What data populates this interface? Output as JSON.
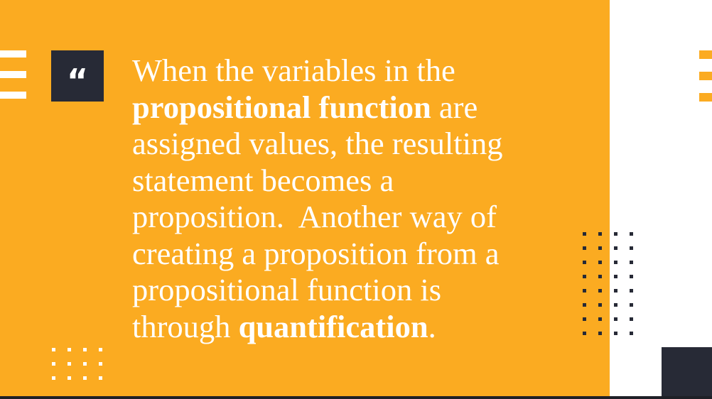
{
  "slide": {
    "colors": {
      "accent": "#fbab21",
      "dark": "#272a36",
      "text": "#ffffff",
      "background": "#ffffff"
    },
    "quote_icon": {
      "name": "quote-mark-icon",
      "glyph": "“"
    },
    "quote_segments": [
      {
        "text": "When the variables in the",
        "bold": false
      },
      {
        "text": "propositional function",
        "bold": true
      },
      {
        "text": " are",
        "bold": false
      },
      {
        "text": "assigned values, the resulting",
        "bold": false
      },
      {
        "text": "statement becomes a",
        "bold": false
      },
      {
        "text": "proposition.  Another way of",
        "bold": false
      },
      {
        "text": "creating a proposition from a",
        "bold": false
      },
      {
        "text": "propositional function is",
        "bold": false
      },
      {
        "text": "through ",
        "bold": false
      },
      {
        "text": "quantification",
        "bold": true
      },
      {
        "text": ".",
        "bold": false
      }
    ]
  }
}
